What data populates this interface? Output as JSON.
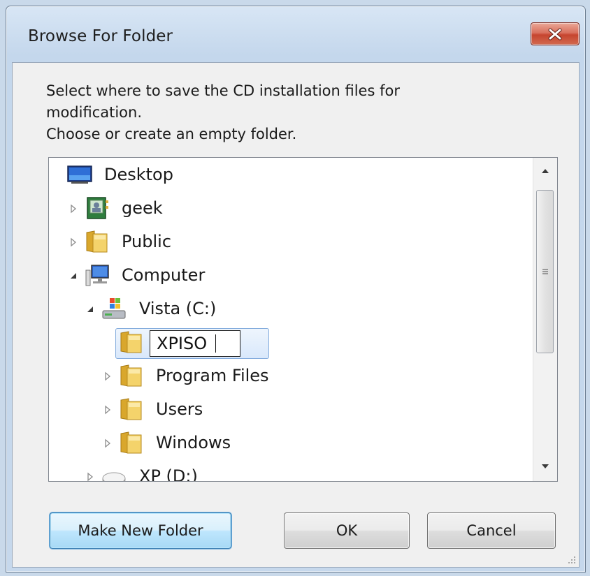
{
  "window": {
    "title": "Browse For Folder"
  },
  "description": {
    "lines": [
      "Select where to save the CD installation files for",
      "modification.",
      "Choose or create an empty folder."
    ]
  },
  "tree": {
    "items": [
      {
        "label": "Desktop",
        "icon": "desktop-icon",
        "expander": "none"
      },
      {
        "label": "geek",
        "icon": "user-folder-icon",
        "expander": "collapsed"
      },
      {
        "label": "Public",
        "icon": "folder-icon",
        "expander": "collapsed"
      },
      {
        "label": "Computer",
        "icon": "computer-icon",
        "expander": "expanded"
      },
      {
        "label": "Vista (C:)",
        "icon": "drive-icon",
        "expander": "expanded"
      },
      {
        "label": "",
        "icon": "folder-icon",
        "expander": "none"
      },
      {
        "label": "Program Files",
        "icon": "folder-icon",
        "expander": "collapsed"
      },
      {
        "label": "Users",
        "icon": "folder-icon",
        "expander": "collapsed"
      },
      {
        "label": "Windows",
        "icon": "folder-icon",
        "expander": "collapsed"
      },
      {
        "label": "XP (D:)",
        "icon": "drive-icon",
        "expander": "collapsed"
      }
    ],
    "rename_value": "XPISO"
  },
  "buttons": {
    "make_new_folder": "Make New Folder",
    "ok": "OK",
    "cancel": "Cancel"
  },
  "colors": {
    "close_button": "#c6452f",
    "selection_border": "#84acdd",
    "focus_button": "#3c7fb1"
  }
}
